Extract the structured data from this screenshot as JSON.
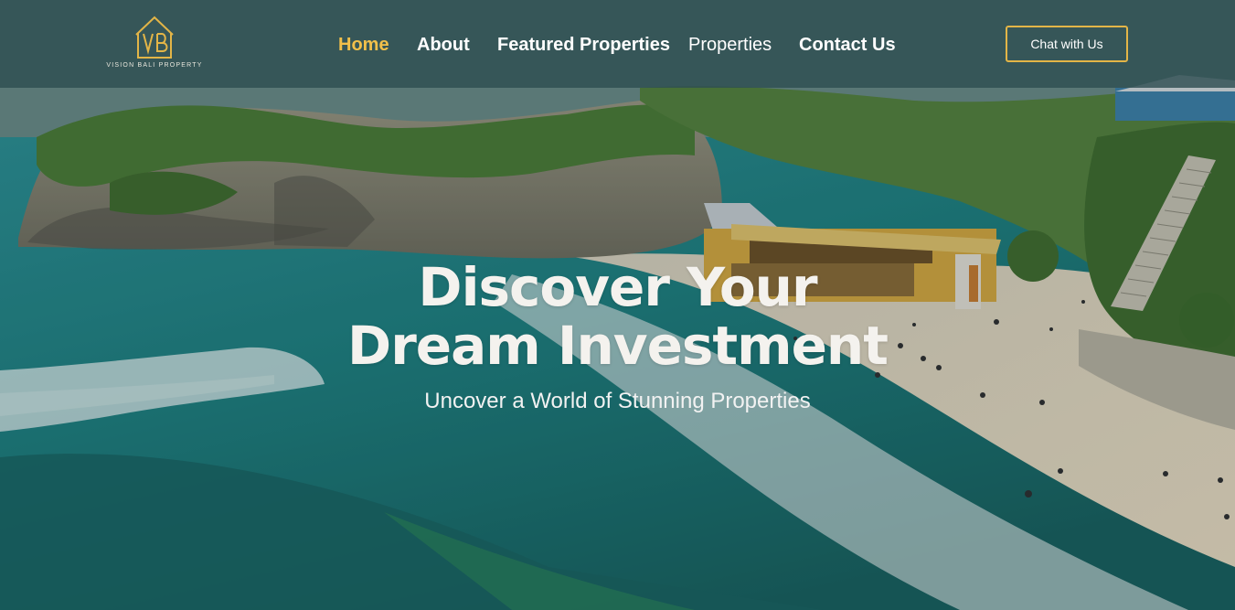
{
  "header": {
    "logo_monogram": "VB",
    "logo_text": "VISION BALI PROPERTY",
    "nav": [
      {
        "label": "Home",
        "active": true
      },
      {
        "label": "About"
      },
      {
        "label": "Featured Properties"
      },
      {
        "label": "Properties"
      },
      {
        "label": "Contact Us"
      }
    ],
    "chat_button": "Chat with Us"
  },
  "hero": {
    "title_line1": "Discover Your",
    "title_line2": "Dream Investment",
    "subtitle": "Uncover a World of Stunning Properties"
  },
  "colors": {
    "accent": "#f2c04a",
    "navbar": "#2e4e52",
    "ocean": "#1f8f8c",
    "sand": "#e8dcc4",
    "foliage": "#4c7a30"
  }
}
